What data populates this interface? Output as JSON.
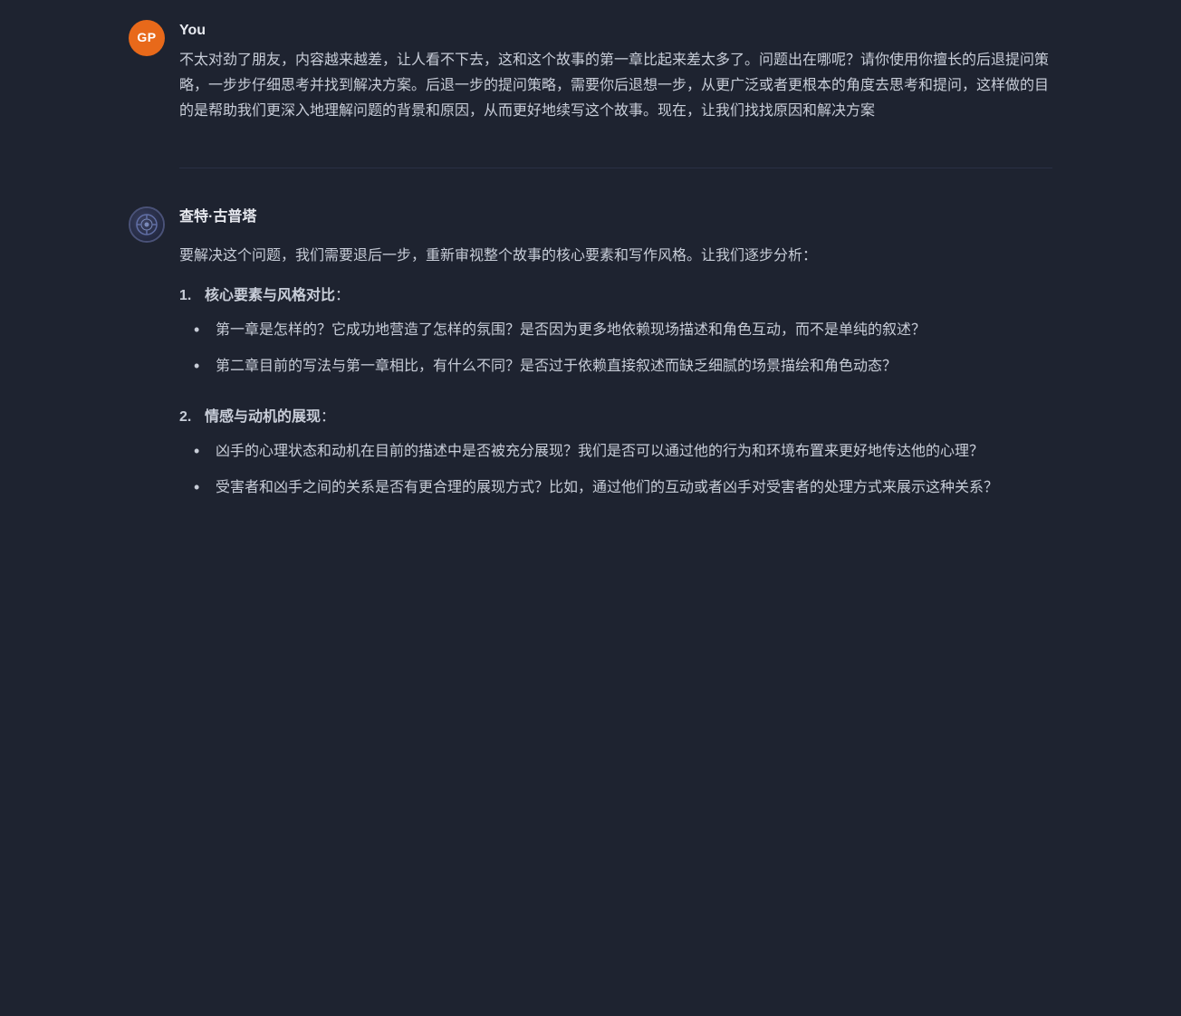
{
  "user": {
    "name": "You",
    "avatar_label": "GP",
    "message": "不太对劲了朋友，内容越来越差，让人看不下去，这和这个故事的第一章比起来差太多了。问题出在哪呢？请你使用你擅长的后退提问策略，一步步仔细思考并找到解决方案。后退一步的提问策略，需要你后退想一步，从更广泛或者更根本的角度去思考和提问，这样做的目的是帮助我们更深入地理解问题的背景和原因，从而更好地续写这个故事。现在，让我们找找原因和解决方案"
  },
  "ai": {
    "name": "查特·古普塔",
    "intro": "要解决这个问题，我们需要退后一步，重新审视整个故事的核心要素和写作风格。让我们逐步分析：",
    "sections": [
      {
        "number": "1.",
        "title": "核心要素与风格对比",
        "colon": "：",
        "bullets": [
          "第一章是怎样的？它成功地营造了怎样的氛围？是否因为更多地依赖现场描述和角色互动，而不是单纯的叙述？",
          "第二章目前的写法与第一章相比，有什么不同？是否过于依赖直接叙述而缺乏细腻的场景描绘和角色动态？"
        ]
      },
      {
        "number": "2.",
        "title": "情感与动机的展现",
        "colon": "：",
        "bullets": [
          "凶手的心理状态和动机在目前的描述中是否被充分展现？我们是否可以通过他的行为和环境布置来更好地传达他的心理？",
          "受害者和凶手之间的关系是否有更合理的展现方式？比如，通过他们的互动或者凶手对受害者的处理方式来展示这种关系？"
        ]
      }
    ]
  },
  "icons": {
    "bullet": "•"
  }
}
